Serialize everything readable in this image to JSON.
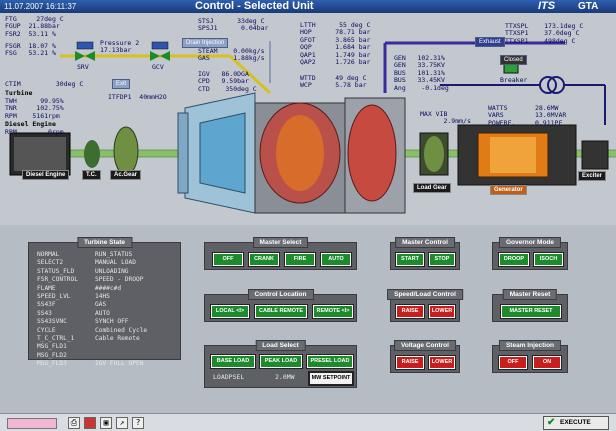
{
  "titlebar": {
    "datetime": "11.07.2007 16:11:37",
    "title": "Control - Selected Unit",
    "brand": "ITS",
    "unit": "GTA"
  },
  "left_readouts": {
    "text": "FTG     27deg C\nFGUP  21.88bar\nFSR2  53.11 %",
    "text2": "FSGR  18.07 %\nFSG   53.21 %",
    "pressure": "Pressure 2\n17.13bar",
    "ctim": "CTIM         30deg C",
    "turbine_hdr": "Turbine",
    "turbine": "TWH      99.95%\nTNR     102.75%\nRPM    5161rpm",
    "diesel_hdr": "Diesel Engine",
    "diesel": "RPM        0rpm",
    "itfdp": "ITFDP1  40mmH2O"
  },
  "center_readouts": {
    "sts": "STSJ      33deg C\nSPSJ1      0.04bar",
    "steam": "STEAM    0.00kg/s\nGAS      1.88kg/s",
    "igv": "IGV   86.0DGA\nCPD   9.59bar\nCTD    350deg C",
    "right1": "LTTH      55 deg C\nHOP      78.71 bar\nGFOT     3.865 bar\nOQP      1.684 bar\nQAP1     1.749 bar\nQAP2     1.726 bar",
    "wttd": "WTTD     49 deg C\nWCP      5.78 bar"
  },
  "right_readouts": {
    "ttx": "TTXSPL    173.1deg C\nTTXSP1    37.0deg C\nTTXSP1    498deg C",
    "gen": "GEN   102.31%\nGEN   33.75KV\nBUS   101.31%\nBUS   33.45KV\nAng    -0.1deg",
    "watts": "WATTS       28.6MW\nVARS        13.0MVAR\nPOWERF.     0.911PF",
    "vib": "MAX VIB\n      2.9mm/s"
  },
  "schem_tags": {
    "drain": "Drain Injection",
    "exhaust": "Exhaust",
    "exit": "Exit",
    "closed": "Closed",
    "breaker": "Breaker",
    "srv": "SRV",
    "gcv": "GCV"
  },
  "schem_labels": {
    "diesel": "Diesel Engine",
    "tc": "T.C.",
    "acgear": "Ac.Gear",
    "loadgear": "Load Gear",
    "generator": "Generator",
    "exciter": "Exciter"
  },
  "turbine_state": {
    "title": "Turbine State",
    "keys": "NORMAL\nSELECT2\nSTATUS_FLD\nFSR_CONTROL\nFLAME\nSPEED_LVL\nSS43F\nSS43\nSS43SVNC\nCYCLE\nT_C_CTRL_1\nMSG_FLD1\nMSG_FLD2\nMSG_FLD3",
    "vals": "RUN_STATUS\nMANUAL LOAD\nUNLOADING\nSPEED - DROOP\n####c#d\n14HS\nGAS\nAUTO\nSYNCH OFF\nCombined Cycle\nCable Remote\n\n\nIGV FULL OPEN"
  },
  "master_select": {
    "title": "Master Select",
    "buttons": [
      "OFF",
      "CRANK",
      "FIRE",
      "AUTO"
    ]
  },
  "control_location": {
    "title": "Control Location",
    "buttons": [
      "LOCAL <I>",
      "CABLE REMOTE",
      "REMOTE <I>"
    ]
  },
  "load_select": {
    "title": "Load Select",
    "buttons": [
      "BASE LOAD",
      "PEAK LOAD",
      "PRESEL LOAD"
    ],
    "loadpsel_label": "LOADPSEL",
    "loadpsel_value": "2.0MW",
    "setpoint": "MW SETPOINT"
  },
  "master_control": {
    "title": "Master Control",
    "buttons": [
      "START",
      "STOP"
    ]
  },
  "speed_load": {
    "title": "Speed/Load Control",
    "buttons": [
      "RAISE",
      "LOWER"
    ]
  },
  "voltage_control": {
    "title": "Voltage Control",
    "buttons": [
      "RAISE",
      "LOWER"
    ]
  },
  "governor_mode": {
    "title": "Governor Mode",
    "buttons": [
      "DROOP",
      "ISOCH"
    ]
  },
  "master_reset": {
    "title": "Master Reset",
    "buttons": [
      "MASTER RESET"
    ]
  },
  "steam_injection": {
    "title": "Steam Injection",
    "buttons": [
      "OFF",
      "ON"
    ]
  },
  "statusbar": {
    "execute": "EXECUTE"
  }
}
